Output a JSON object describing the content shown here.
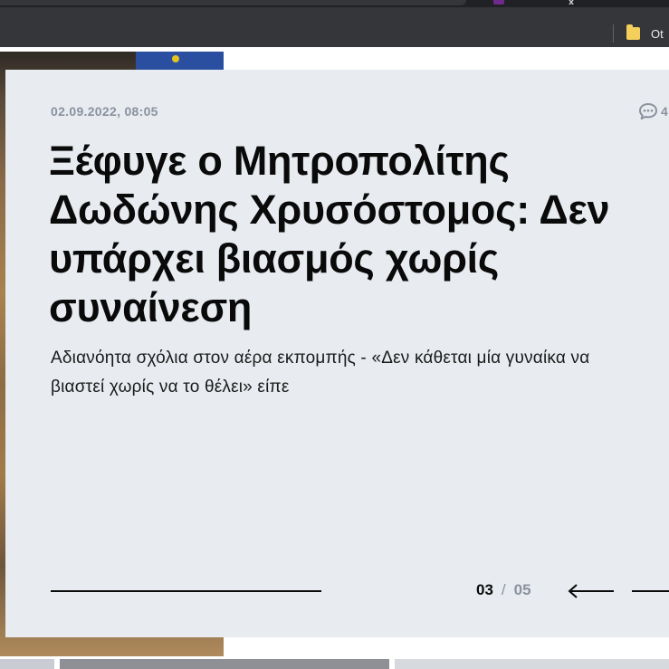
{
  "browser": {
    "tab_close_glyph": "x",
    "bookmark_label": "Ot"
  },
  "slide": {
    "date": "02.09.2022, 08:05",
    "comments_count": "4",
    "headline": "Ξέφυγε ο Μητροπολίτης Δωδώνης Χρυσόστομος: Δεν υπάρχει βιασμός χωρίς συναίνεση",
    "subtitle": "Αδιανόητα σχόλια στον αέρα εκπομπής - «Δεν κάθεται μία γυναίκα να βιαστεί χωρίς να το θέλει» είπε",
    "current_slide": "03",
    "separator": "/",
    "total_slides": "05",
    "progress": 0.6
  },
  "colors": {
    "card_background": "#e8ecf1",
    "headline": "#0a0a0a",
    "meta": "#8a929e",
    "browser_bar": "#35363a"
  },
  "icons": {
    "comments": "speech-bubble-icon",
    "prev": "arrow-left-icon",
    "next": "arrow-right-icon",
    "bookmark": "folder-icon"
  }
}
